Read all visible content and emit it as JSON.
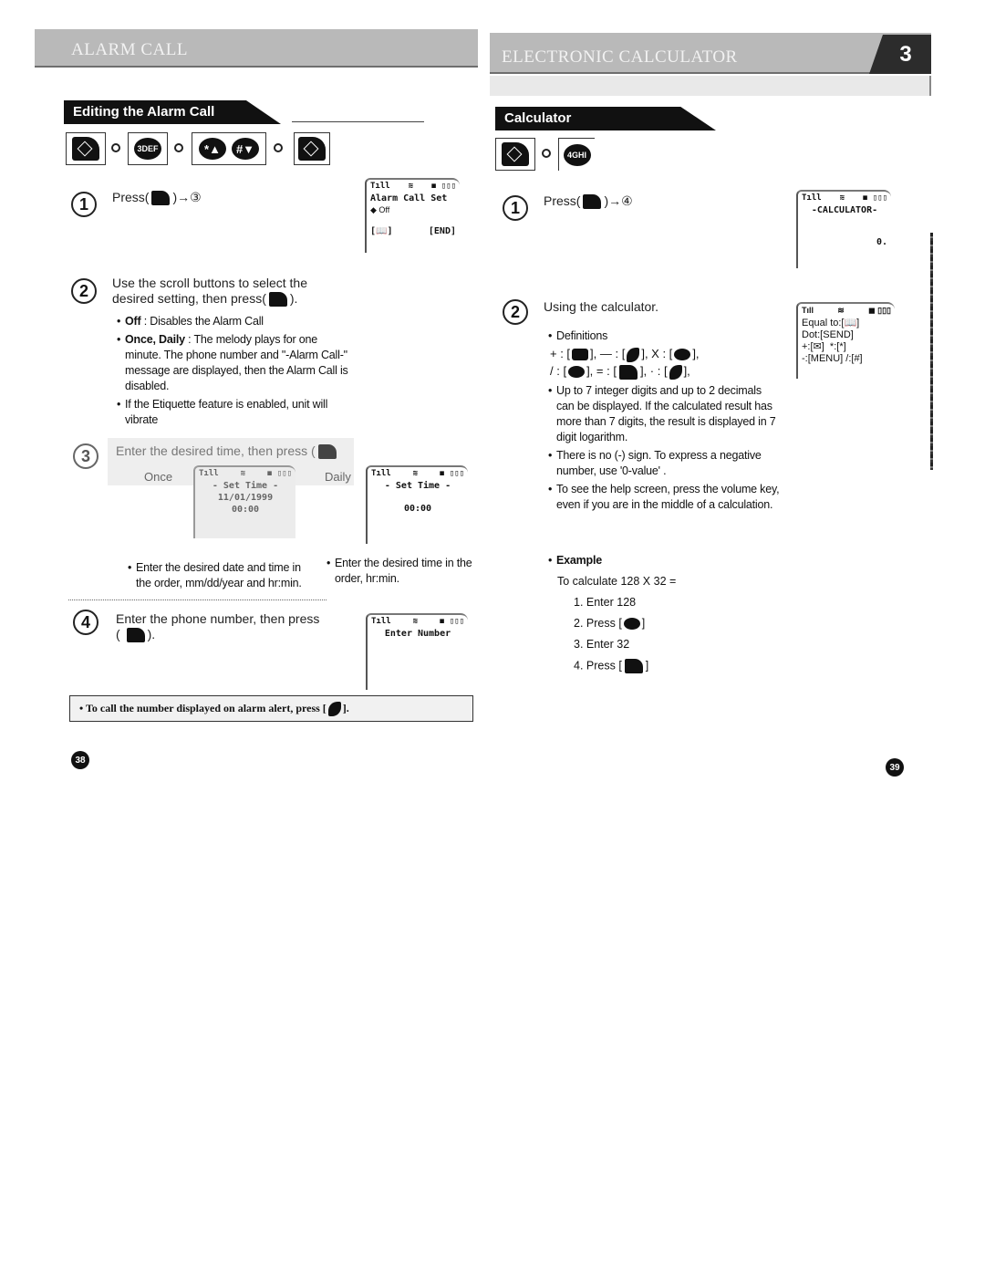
{
  "left_page": {
    "header_title": "ALARM CALL",
    "section_tag": "Editing the Alarm Call",
    "key_sequence": [
      "menu-send-key",
      "3DEF",
      "*▲",
      "#▼",
      "menu-send-key"
    ],
    "key_labels": {
      "k3": "3DEF",
      "kstar": "*▲",
      "khash": "#▼"
    },
    "steps": [
      {
        "num": "1",
        "text": "Press(",
        "after": ")→③"
      },
      {
        "num": "2",
        "text": "Use the scroll buttons to select the desired setting, then press(",
        "after": ")."
      },
      {
        "num": "3",
        "text": "Enter the desired time, then press ("
      },
      {
        "num": "4",
        "text": "Enter the phone number, then press",
        "after": ")."
      }
    ],
    "step2_bullets": [
      {
        "bold": "Off",
        "text": " : Disables the Alarm Call"
      },
      {
        "bold": "Once, Daily",
        "text": " : The melody plays for one minute. The phone number and \"-Alarm Call-\" message are displayed, then the Alarm Call is disabled."
      },
      {
        "bold": "",
        "text": "If the Etiquette feature is enabled, unit will vibrate"
      }
    ],
    "screen_alarm_set": {
      "title": "Alarm Call Set",
      "option": "◆ Off",
      "left_soft": "[📖]",
      "right_soft": "[END]"
    },
    "once_label": "Once",
    "daily_label": "Daily",
    "screen_once": {
      "title": "- Set Time -",
      "date": "11/01/1999",
      "time": "00:00"
    },
    "screen_daily": {
      "title": "- Set Time -",
      "time": "00:00"
    },
    "once_note": "Enter the desired date and time in the order, mm/dd/year and hr:min.",
    "daily_note": "Enter the desired time in the order, hr:min.",
    "screen_enter_number": {
      "title": "Enter Number"
    },
    "note_box": "• To call the number displayed on alarm alert, press [",
    "note_box_end": "].",
    "page_number": "38"
  },
  "right_page": {
    "header_title": "ELECTRONIC CALCULATOR",
    "chapter_number": "3",
    "section_tag": "Calculator",
    "key_labels": {
      "k4": "4GHI"
    },
    "steps": [
      {
        "num": "1",
        "text": "Press(",
        "after": ")→④"
      },
      {
        "num": "2",
        "text": "Using the calculator."
      }
    ],
    "screen_calculator": {
      "title": "-CALCULATOR-",
      "value": "0."
    },
    "screen_help": {
      "lines": [
        "Equal to:[📖]",
        "Dot:[SEND]",
        "+:[✉]  *:[*]",
        "-:[MENU] /:[#]"
      ]
    },
    "definitions_label": "Definitions",
    "definitions_line1": [
      "+ : [",
      "], — : [",
      "], X : [",
      "],"
    ],
    "definitions_line2": [
      "/ : [",
      "], = : [",
      "], · : [",
      "],"
    ],
    "bullets": [
      "Up to 7 integer digits and up to 2 decimals can be displayed. If the calculated result has more than 7 digits, the result is displayed in 7 digit logarithm.",
      "There is no (-) sign. To express a negative number, use  '0-value' .",
      "To see the help screen, press the volume key, even if you are in the middle of a calculation."
    ],
    "example_label": "Example",
    "example_intro": "To calculate 128 X 32 =",
    "example_steps": [
      "1. Enter 128",
      "2. Press [",
      "3. Enter 32",
      "4. Press ["
    ],
    "page_number": "39"
  },
  "status_bar": {
    "signal": "Tıll",
    "mode": "≋",
    "icons": "◼ ▯▯▯"
  }
}
